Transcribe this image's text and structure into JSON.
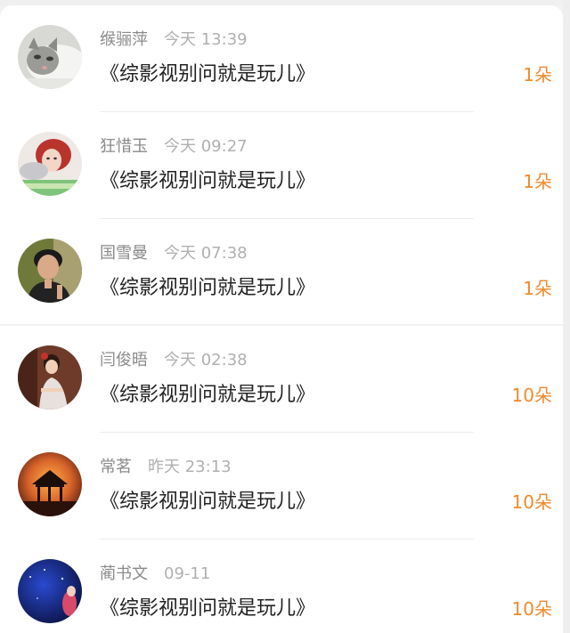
{
  "gifts": [
    {
      "name": "缑骊萍",
      "time": "今天 13:39",
      "title": "《综影视别问就是玩儿》",
      "count": "1朵",
      "avatar": "cat-avatar"
    },
    {
      "name": "狂惜玉",
      "time": "今天 09:27",
      "title": "《综影视别问就是玩儿》",
      "count": "1朵",
      "avatar": "girl-red-hair-avatar"
    },
    {
      "name": "国雪曼",
      "time": "今天 07:38",
      "title": "《综影视别问就是玩儿》",
      "count": "1朵",
      "avatar": "man-portrait-avatar"
    },
    {
      "name": "闫俊晤",
      "time": "今天 02:38",
      "title": "《综影视别问就是玩儿》",
      "count": "10朵",
      "avatar": "woman-seated-avatar"
    },
    {
      "name": "常茗",
      "time": "昨天 23:13",
      "title": "《综影视别问就是玩儿》",
      "count": "10朵",
      "avatar": "pavilion-sunset-avatar"
    },
    {
      "name": "蔺书文",
      "time": "09-11",
      "title": "《综影视别问就是玩儿》",
      "count": "10朵",
      "avatar": "night-sky-avatar"
    }
  ],
  "colors": {
    "count": "#f08a2c",
    "name": "#8a8a8a",
    "time": "#b0b0b0",
    "title": "#222222"
  }
}
